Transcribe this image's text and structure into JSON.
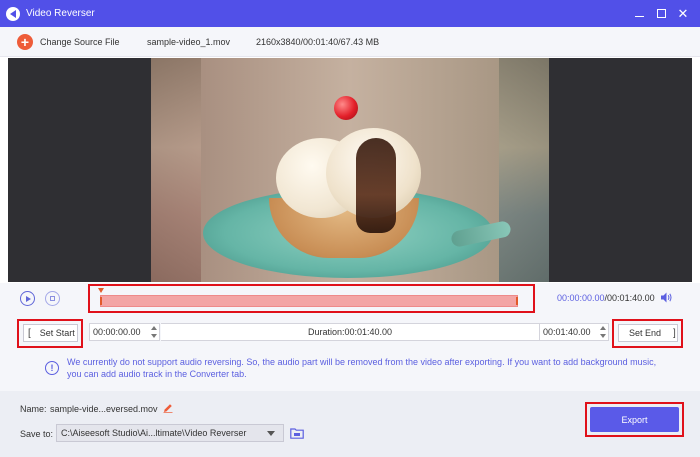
{
  "window": {
    "title": "Video Reverser",
    "controls": [
      "minimize-icon",
      "maximize-icon",
      "close-icon"
    ]
  },
  "infobar": {
    "change_source_label": "Change Source File",
    "file_name": "sample-video_1.mov",
    "file_meta": "2160x3840/00:01:40/67.43 MB"
  },
  "playback": {
    "current_time": "00:00:00.00",
    "total_time": "/00:01:40.00"
  },
  "trim": {
    "set_start_label": "Set Start",
    "set_end_label": "Set End",
    "start_time": "00:00:00.00",
    "end_time": "00:01:40.00",
    "duration": "Duration:00:01:40.00"
  },
  "notice": {
    "text": "We currently do not support audio reversing. So, the audio part will be removed from the video after exporting. If you want to add background music, you can add audio track in the Converter tab."
  },
  "output": {
    "name_label": "Name:",
    "name_value": "sample-vide...eversed.mov",
    "save_to_label": "Save to:",
    "save_path": "C:\\Aiseesoft Studio\\Ai...ltimate\\Video Reverser",
    "export_label": "Export"
  },
  "colors": {
    "accent": "#5150e8",
    "highlight_border": "#e0111a",
    "add_button": "#ee5c39",
    "notice_text": "#5b5fe0",
    "timeline_fill": "#f3a5a5"
  }
}
